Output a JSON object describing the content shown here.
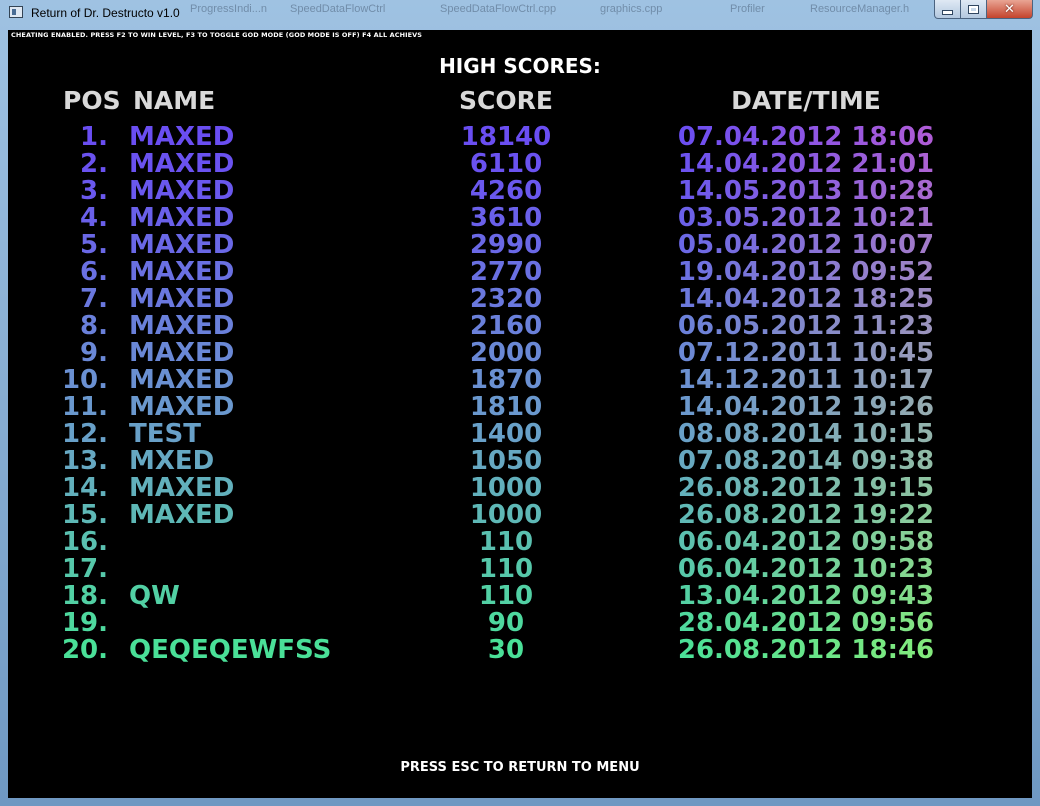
{
  "window": {
    "title": "Return of Dr. Destructo v1.0",
    "background_tabs": [
      "ProgressIndi...n",
      "SpeedDataFlowCtrl",
      "SpeedDataFlowCtrl.cpp",
      "graphics.cpp",
      "Profiler",
      "ResourceManager.h"
    ]
  },
  "game": {
    "cheat_notice": "CHEATING ENABLED. PRESS F2 TO WIN LEVEL, F3 TO TOGGLE GOD MODE (GOD MODE IS OFF) F4 ALL ACHIEVS",
    "high_scores_title": "HIGH SCORES:",
    "headers": {
      "pos": "POS",
      "name": "NAME",
      "score": "SCORE",
      "datetime": "DATE/TIME"
    },
    "rows": [
      {
        "pos": "1.",
        "name": "MAXED",
        "score": "18140",
        "datetime": "07.04.2012 18:06",
        "color_left": "#6a4ef2",
        "color_right": "#b05cd6"
      },
      {
        "pos": "2.",
        "name": "MAXED",
        "score": "6110",
        "datetime": "14.04.2012 21:01",
        "color_left": "#6a52f0",
        "color_right": "#ad62d2"
      },
      {
        "pos": "3.",
        "name": "MAXED",
        "score": "4260",
        "datetime": "14.05.2013 10:28",
        "color_left": "#6a58ee",
        "color_right": "#aa69cf"
      },
      {
        "pos": "4.",
        "name": "MAXED",
        "score": "3610",
        "datetime": "03.05.2012 10:21",
        "color_left": "#6a60ea",
        "color_right": "#a672cc"
      },
      {
        "pos": "5.",
        "name": "MAXED",
        "score": "2990",
        "datetime": "05.04.2012 10:07",
        "color_left": "#6a68e6",
        "color_right": "#a47bc8"
      },
      {
        "pos": "6.",
        "name": "MAXED",
        "score": "2770",
        "datetime": "19.04.2012 09:52",
        "color_left": "#6a70e2",
        "color_right": "#a184c4"
      },
      {
        "pos": "7.",
        "name": "MAXED",
        "score": "2320",
        "datetime": "14.04.2012 18:25",
        "color_left": "#6a78de",
        "color_right": "#9f8cc0"
      },
      {
        "pos": "8.",
        "name": "MAXED",
        "score": "2160",
        "datetime": "06.05.2012 11:23",
        "color_left": "#6a80da",
        "color_right": "#9c94bc"
      },
      {
        "pos": "9.",
        "name": "MAXED",
        "score": "2000",
        "datetime": "07.12.2011 10:45",
        "color_left": "#6a88d6",
        "color_right": "#9a9cb8"
      },
      {
        "pos": "10.",
        "name": "MAXED",
        "score": "1870",
        "datetime": "14.12.2011 10:17",
        "color_left": "#6a90d2",
        "color_right": "#98a4b4"
      },
      {
        "pos": "11.",
        "name": "MAXED",
        "score": "1810",
        "datetime": "14.04.2012 19:26",
        "color_left": "#6a98ce",
        "color_right": "#96acb0"
      },
      {
        "pos": "12.",
        "name": "TEST",
        "score": "1400",
        "datetime": "08.08.2014 10:15",
        "color_left": "#68a0c8",
        "color_right": "#94b4ac"
      },
      {
        "pos": "13.",
        "name": "MXED",
        "score": "1050",
        "datetime": "07.08.2014 09:38",
        "color_left": "#66a8c2",
        "color_right": "#92bca6"
      },
      {
        "pos": "14.",
        "name": "MAXED",
        "score": "1000",
        "datetime": "26.08.2012 19:15",
        "color_left": "#62b0bc",
        "color_right": "#90c4a0"
      },
      {
        "pos": "15.",
        "name": "MAXED",
        "score": "1000",
        "datetime": "26.08.2012 19:22",
        "color_left": "#5eb8b6",
        "color_right": "#8ecc9a"
      },
      {
        "pos": "16.",
        "name": "",
        "score": "110",
        "datetime": "06.04.2012 09:58",
        "color_left": "#5ac0b0",
        "color_right": "#8cd294"
      },
      {
        "pos": "17.",
        "name": "",
        "score": "110",
        "datetime": "06.04.2012 10:23",
        "color_left": "#56c8aa",
        "color_right": "#8ad88e"
      },
      {
        "pos": "18.",
        "name": "QW",
        "score": "110",
        "datetime": "13.04.2012 09:43",
        "color_left": "#52d0a4",
        "color_right": "#88de88"
      },
      {
        "pos": "19.",
        "name": "",
        "score": "90",
        "datetime": "28.04.2012 09:56",
        "color_left": "#4ed89e",
        "color_right": "#86e482"
      },
      {
        "pos": "20.",
        "name": "QEQEQEWFSS",
        "score": "30",
        "datetime": "26.08.2012 18:46",
        "color_left": "#4ae098",
        "color_right": "#84ea7c"
      }
    ],
    "footer": "PRESS ESC TO RETURN TO MENU"
  }
}
